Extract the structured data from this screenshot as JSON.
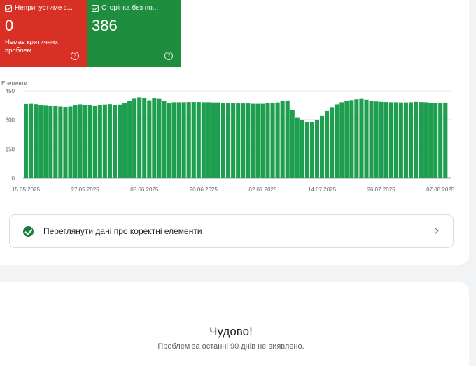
{
  "tiles": {
    "errors": {
      "label": "Неприпустиме з...",
      "count": "0",
      "sublabel": "Немає критичних проблем",
      "help": "?",
      "color": "#d93025"
    },
    "valid": {
      "label": "Сторінка без по...",
      "count": "386",
      "help": "?",
      "color": "#1e8e3e"
    }
  },
  "chart_data": {
    "type": "bar",
    "ylabel": "Елементи",
    "ylim": [
      0,
      450
    ],
    "yticks": [
      0,
      150,
      300,
      450
    ],
    "xtick_labels": [
      "15.05.2025",
      "27.05.2025",
      "08.06.2025",
      "20.06.2025",
      "02.07.2025",
      "14.07.2025",
      "26.07.2025",
      "07.08.2025"
    ],
    "series_color": "#1e9e4f",
    "values": [
      382,
      383,
      381,
      376,
      373,
      371,
      371,
      369,
      367,
      369,
      376,
      380,
      378,
      375,
      371,
      376,
      379,
      381,
      378,
      379,
      386,
      398,
      409,
      416,
      414,
      401,
      410,
      408,
      398,
      385,
      391,
      391,
      391,
      392,
      392,
      392,
      391,
      391,
      390,
      390,
      388,
      386,
      385,
      385,
      385,
      385,
      383,
      383,
      383,
      386,
      387,
      390,
      399,
      400,
      351,
      311,
      299,
      291,
      291,
      299,
      321,
      346,
      366,
      380,
      391,
      398,
      402,
      406,
      408,
      404,
      398,
      395,
      393,
      392,
      391,
      391,
      390,
      390,
      391,
      393,
      392,
      391,
      389,
      387,
      386,
      389
    ]
  },
  "correct_row": {
    "label": "Переглянути дані про коректні елементи"
  },
  "summary": {
    "title": "Чудово!",
    "subtitle": "Проблем за останні 90 днів не виявлено."
  }
}
